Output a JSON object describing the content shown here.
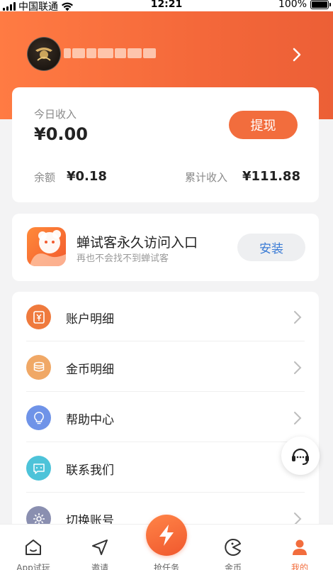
{
  "status_bar": {
    "carrier": "中国联通",
    "time": "12:21",
    "battery": "100%"
  },
  "profile": {
    "avatar_icon": "avatar-logo-icon",
    "username_blurred": true
  },
  "income": {
    "today_label": "今日收入",
    "today_amount": "¥0.00",
    "withdraw_label": "提现",
    "balance_label": "余额",
    "balance_value": "¥0.18",
    "total_label": "累计收入",
    "total_value": "¥111.88"
  },
  "install": {
    "title": "蝉试客永久访问入口",
    "subtitle": "再也不会找不到蝉试客",
    "button": "安装"
  },
  "menu": {
    "items": [
      {
        "label": "账户明细",
        "icon": "yuan-wallet-icon",
        "color": "#ef7a3d"
      },
      {
        "label": "金币明细",
        "icon": "coin-stack-icon",
        "color": "#f0a866"
      },
      {
        "label": "帮助中心",
        "icon": "lightbulb-icon",
        "color": "#6f93e8"
      },
      {
        "label": "联系我们",
        "icon": "chat-bubble-icon",
        "color": "#4dc3d9"
      },
      {
        "label": "切换账号",
        "icon": "gear-icon",
        "color": "#8a8fb0"
      }
    ]
  },
  "tabs": [
    {
      "label": "App试玩",
      "icon": "home-icon"
    },
    {
      "label": "邀请",
      "icon": "send-icon"
    },
    {
      "label": "抢任务",
      "icon": "lightning-icon"
    },
    {
      "label": "金币",
      "icon": "coin-icon"
    },
    {
      "label": "我的",
      "icon": "user-icon",
      "active": true
    }
  ],
  "colors": {
    "accent": "#f26d3d",
    "install_link": "#3a7bd5"
  }
}
